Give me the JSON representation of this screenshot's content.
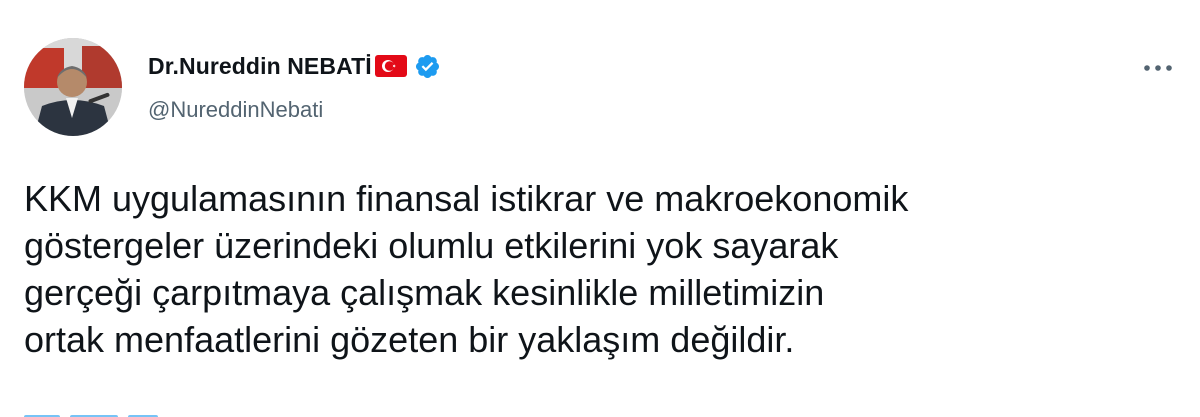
{
  "author": {
    "display_name": "Dr.Nureddin NEBATİ",
    "handle": "@NureddinNebati",
    "flag_icon": "turkey-flag-icon",
    "verified_icon": "verified-badge-icon",
    "verified_color": "#1d9bf0"
  },
  "tweet": {
    "text": "KKM uygulamasının finansal istikrar ve makroekonomik\ngöstergeler üzerindeki olumlu etkilerini yok sayarak\ngerçeği çarpıtmaya çalışmak kesinlikle milletimizin\nortak menfaatlerini gözeten bir yaklaşım değildir."
  },
  "menu": {
    "more_icon": "more-options-icon"
  },
  "colors": {
    "text": "#0f1419",
    "secondary": "#536471",
    "flag_red": "#e30a17"
  }
}
